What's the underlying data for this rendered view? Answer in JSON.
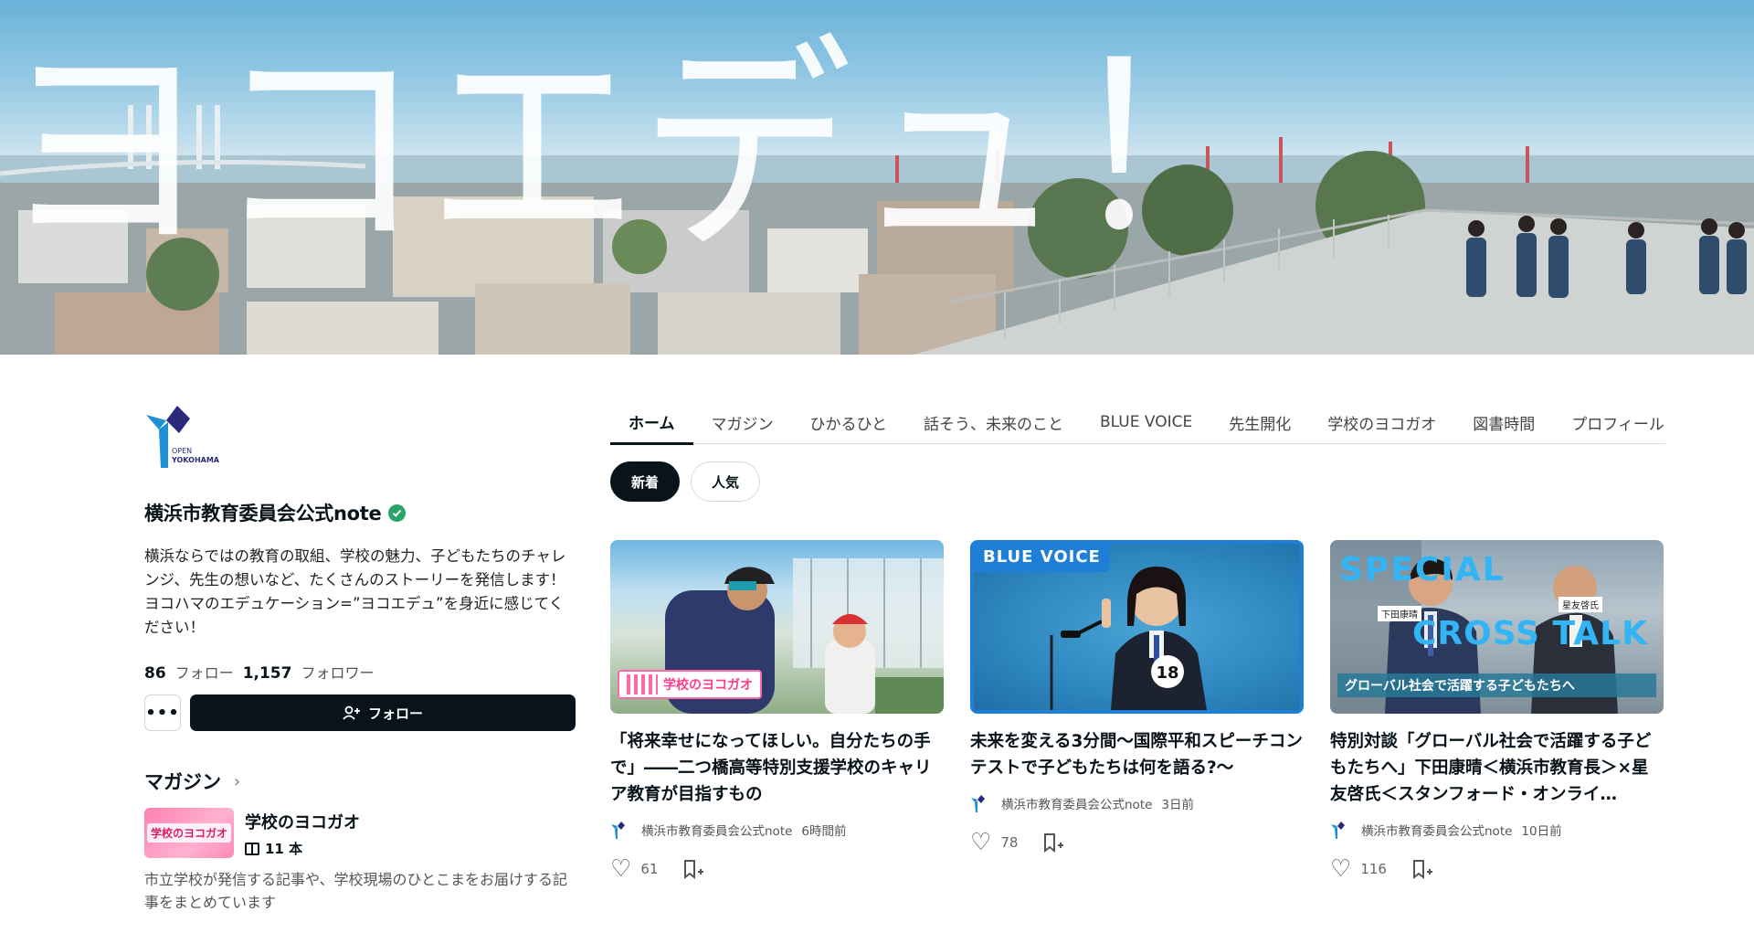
{
  "hero": {
    "title": "ヨコエデュ！"
  },
  "logo": {
    "line1": "OPEN",
    "line2": "YOKOHAMA"
  },
  "creator": {
    "name": "横浜市教育委員会公式note",
    "bio": "横浜ならではの教育の取組、学校の魅力、子どもたちのチャレンジ、先生の想いなど、たくさんのストーリーを発信します！ヨコハマのエデュケーション=”ヨコエデュ”を身近に感じてください！",
    "follow_count": "86",
    "follow_label": "フォロー",
    "follower_count": "1,157",
    "follower_label": "フォロワー",
    "more_label": "•••",
    "follow_button": "フォロー"
  },
  "magazine": {
    "heading": "マガジン",
    "item": {
      "thumb_text": "学校のヨコガオ",
      "title": "学校のヨコガオ",
      "count": "11 本",
      "description": "市立学校が発信する記事や、学校現場のひとこまをお届けする記事をまとめています"
    }
  },
  "tabs": [
    "ホーム",
    "マガジン",
    "ひかるひと",
    "話そう、未来のこと",
    "BLUE VOICE",
    "先生開化",
    "学校のヨコガオ",
    "図書時間",
    "プロフィール"
  ],
  "filters": [
    "新着",
    "人気"
  ],
  "cards": [
    {
      "thumb_badge": "学校のヨコガオ",
      "title": "「将来幸せになってほしい。自分たちの手で」――二つ橋高等特別支援学校のキャリア教育が目指すもの",
      "author": "横浜市教育委員会公式note",
      "time": "6時間前",
      "likes": "61"
    },
    {
      "thumb_badge": "BLUE VOICE",
      "thumb_number": "18",
      "title": "未来を変える3分間〜国際平和スピーチコンテストで子どもたちは何を語る?〜",
      "author": "横浜市教育委員会公式note",
      "time": "3日前",
      "likes": "78"
    },
    {
      "thumb_special": "SPECIAL",
      "thumb_cross": "CROSS TALK",
      "thumb_name1": "下田康晴",
      "thumb_name2": "星友啓氏",
      "thumb_caption": "グローバル社会で活躍する子どもたちへ",
      "title": "特別対談「グローバル社会で活躍する子どもたちへ」下田康晴＜横浜市教育長＞×星友啓氏＜スタンフォード・オンライ…",
      "author": "横浜市教育委員会公式note",
      "time": "10日前",
      "likes": "116"
    }
  ],
  "colors": {
    "dark": "#08131a",
    "accent_blue": "#1f7fd6",
    "verified": "#2aa36a",
    "pink": "#ff7fb0"
  }
}
